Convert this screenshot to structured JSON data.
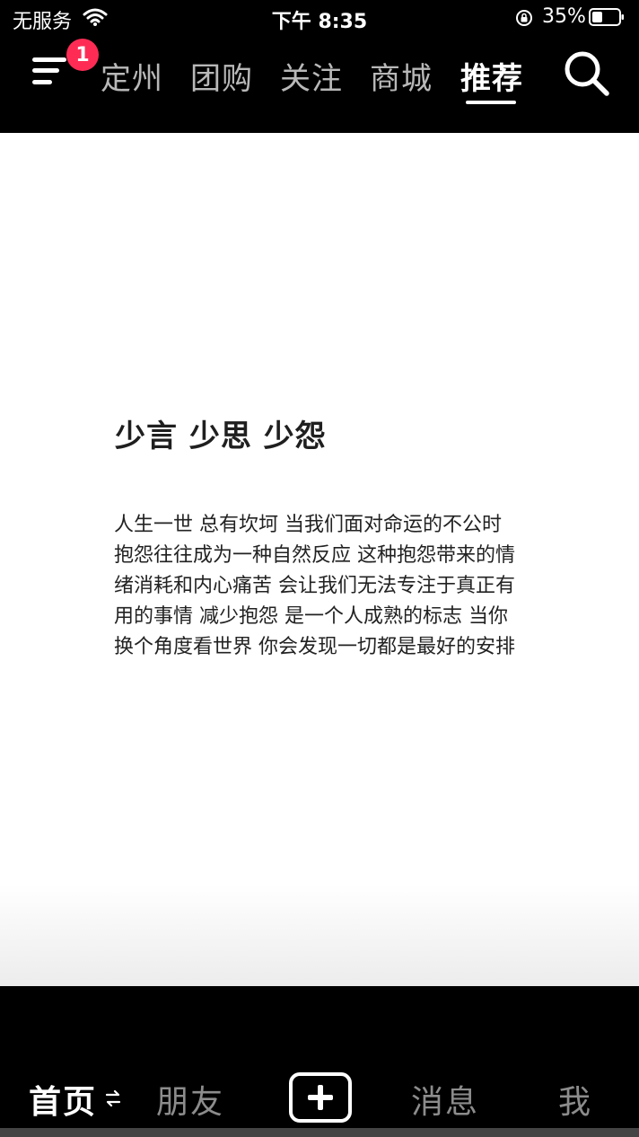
{
  "status_bar": {
    "carrier": "无服务",
    "time": "下午 8:35",
    "battery": "35%"
  },
  "top_nav": {
    "badge_count": "1",
    "tabs": [
      {
        "label": "定州"
      },
      {
        "label": "团购"
      },
      {
        "label": "关注"
      },
      {
        "label": "商城"
      },
      {
        "label": "推荐",
        "active": true
      }
    ]
  },
  "post": {
    "title": "少言 少思 少怨",
    "body": "人生一世 总有坎坷 当我们面对命运的不公时 抱怨往往成为一种自然反应 这种抱怨带来的情绪消耗和内心痛苦 会让我们无法专注于真正有用的事情 减少抱怨 是一个人成熟的标志 当你换个角度看世界 你会发现一切都是最好的安排"
  },
  "bottom_nav": {
    "home": "首页",
    "friends": "朋友",
    "messages": "消息",
    "me": "我"
  },
  "colors": {
    "badge": "#fe2c55",
    "background": "#000000",
    "card": "#ffffff"
  }
}
